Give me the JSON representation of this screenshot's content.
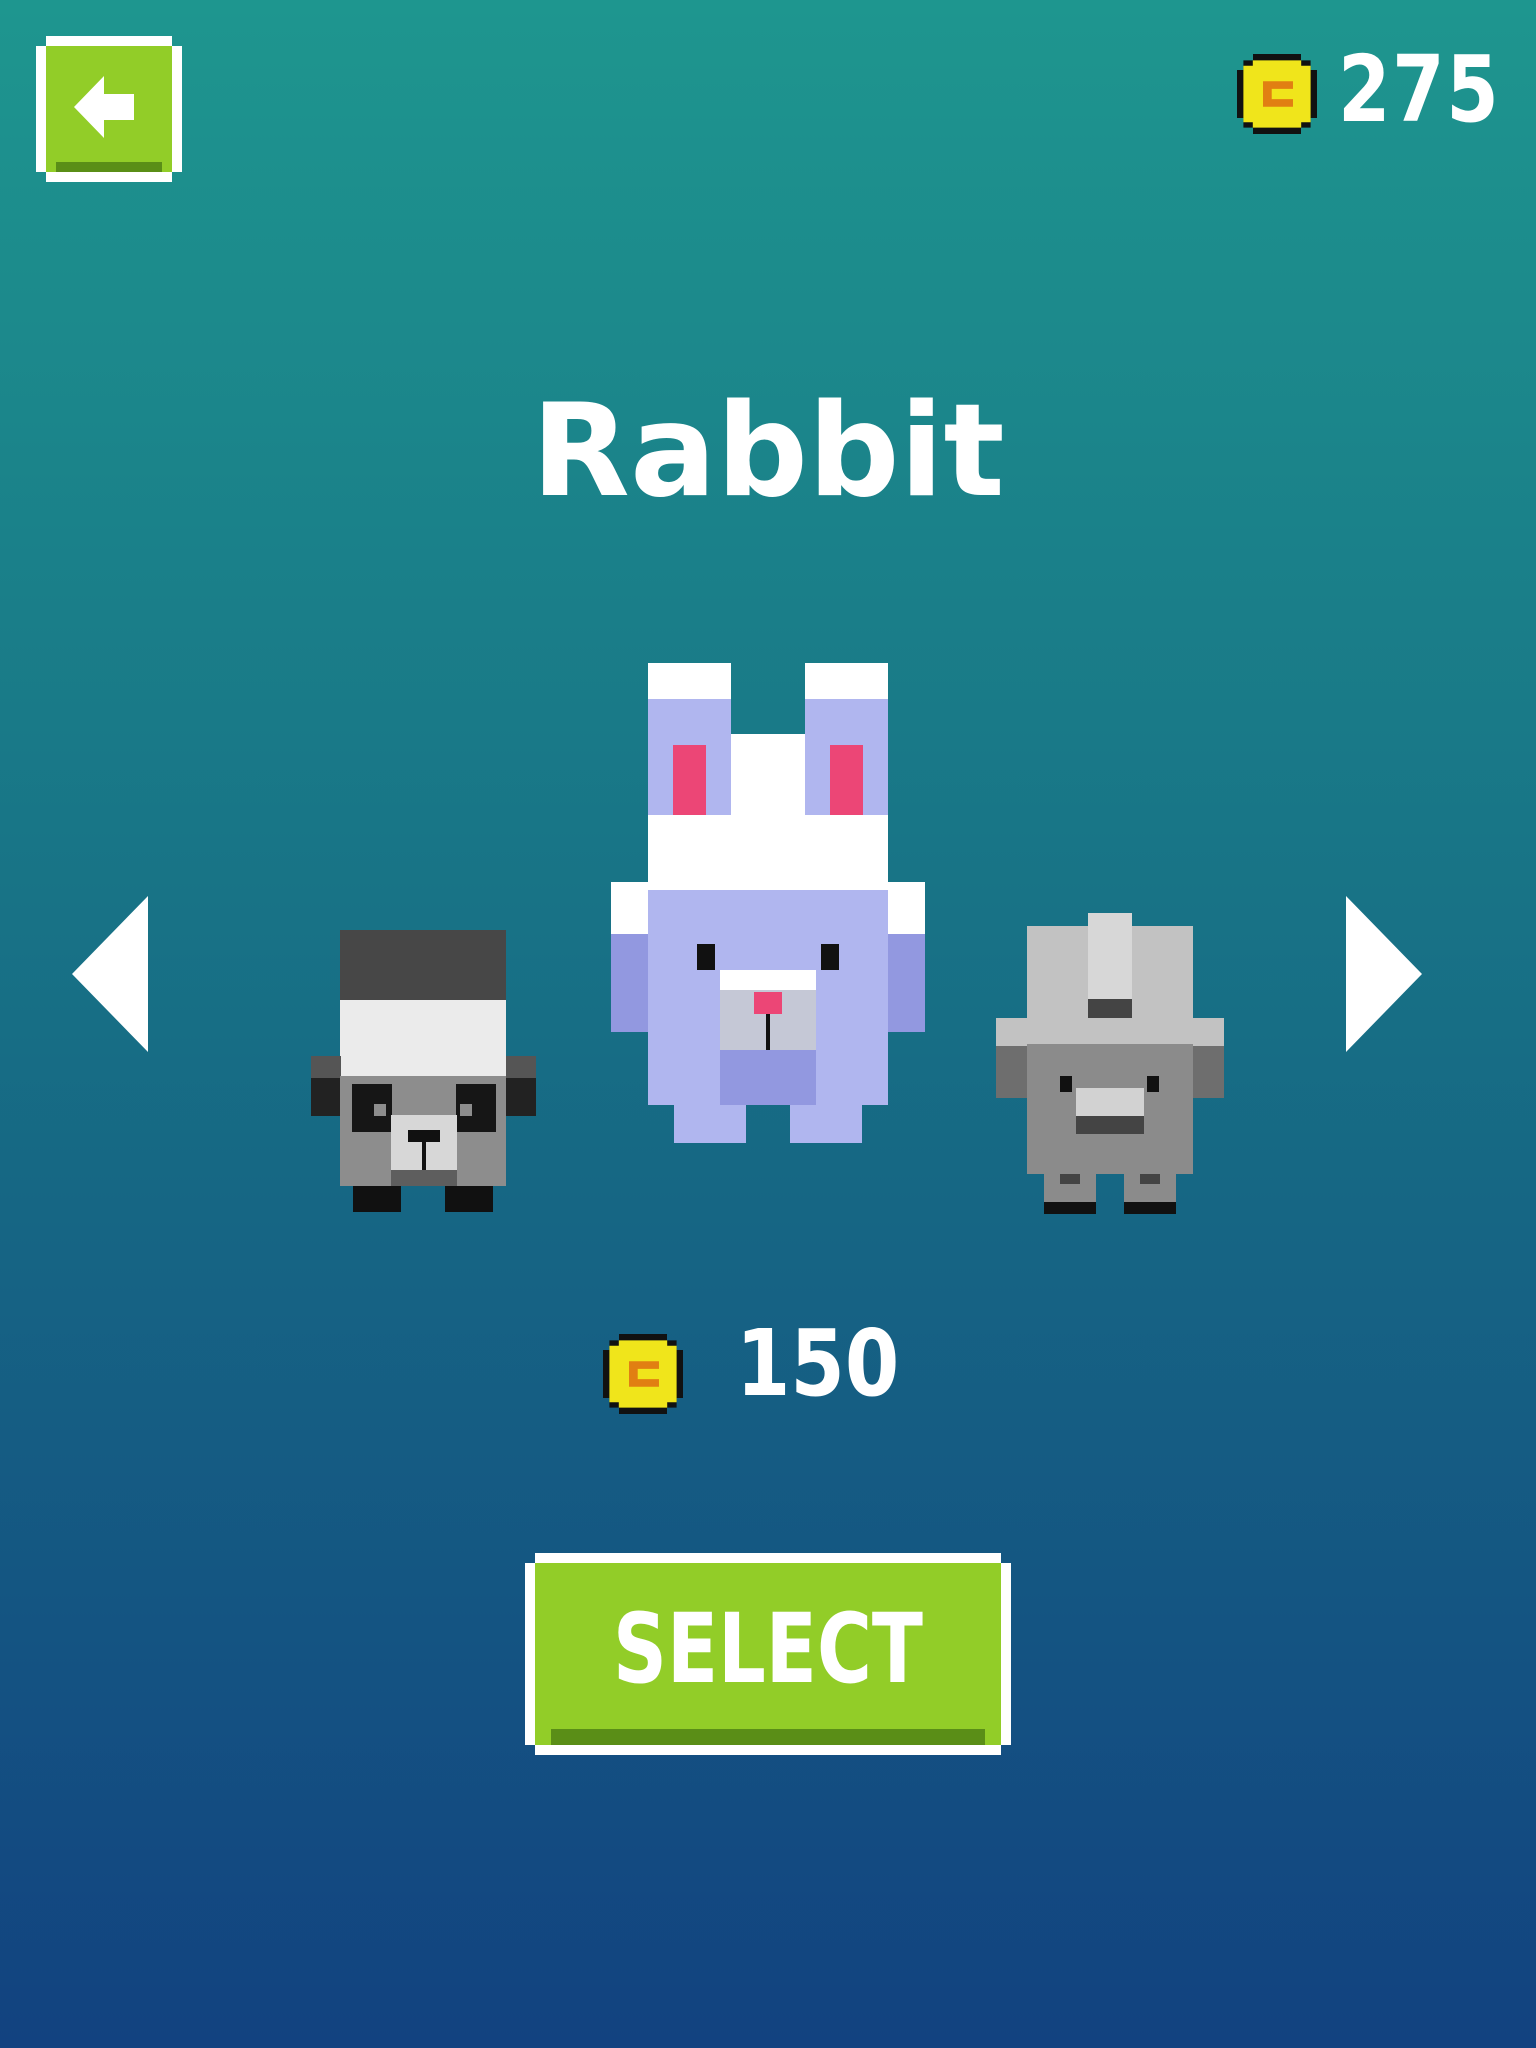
{
  "hud": {
    "coin_total": "275",
    "back_icon": "left-arrow-icon",
    "coin_icon": "coin-icon"
  },
  "character": {
    "name": "Rabbit",
    "price": "150"
  },
  "carousel": {
    "prev_icon": "triangle-left-icon",
    "next_icon": "triangle-right-icon",
    "left_character": "panda",
    "center_character": "rabbit",
    "right_character": "rhino"
  },
  "buttons": {
    "select_label": "SELECT"
  },
  "colors": {
    "background_top": "#1e968f",
    "background_bottom": "#124280",
    "button_green": "#92cd28",
    "coin_yellow": "#f0e51b",
    "rabbit_purple": "#b0b6ef",
    "rabbit_pink": "#ec4676"
  }
}
